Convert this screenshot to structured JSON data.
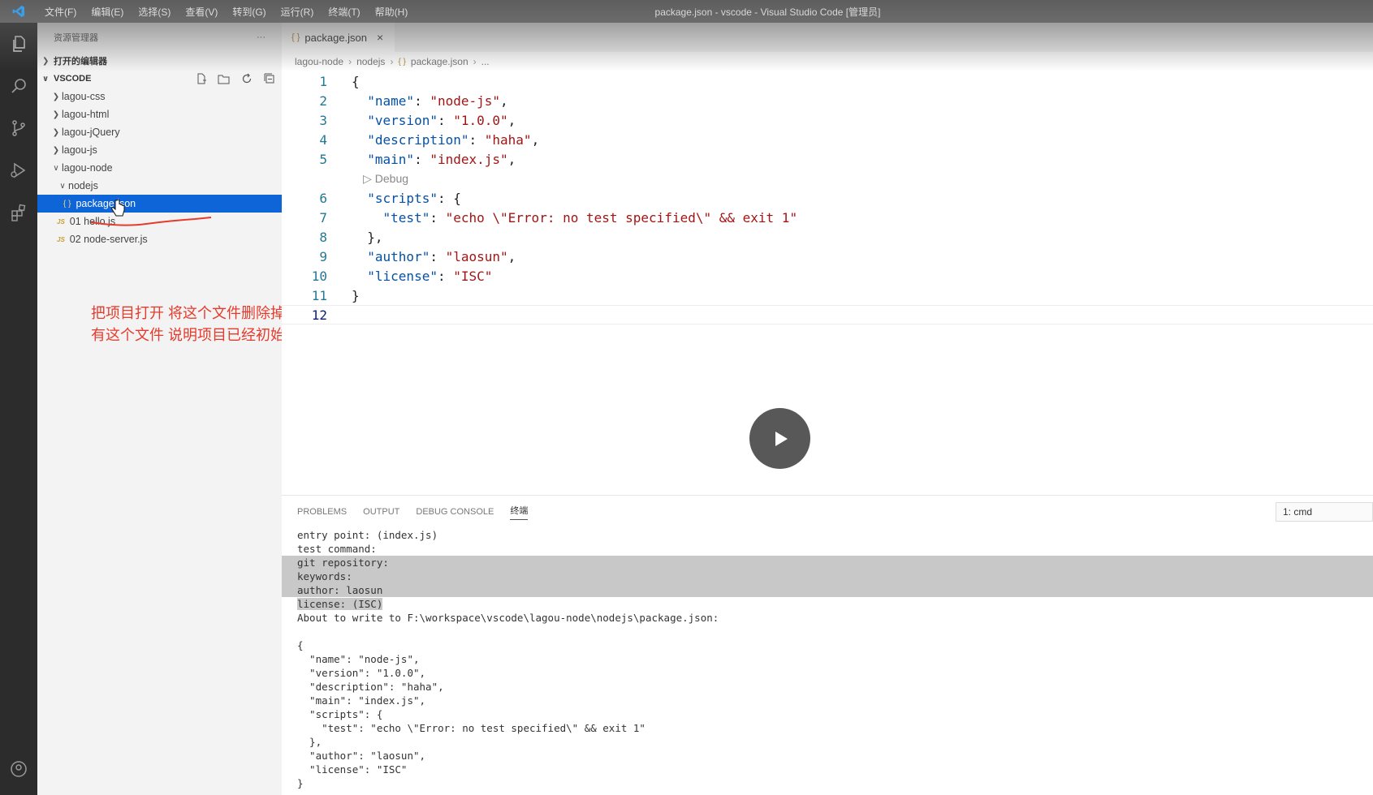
{
  "titlebar": {
    "menu": [
      "文件(F)",
      "编辑(E)",
      "选择(S)",
      "查看(V)",
      "转到(G)",
      "运行(R)",
      "终端(T)",
      "帮助(H)"
    ],
    "window_title": "package.json - vscode - Visual Studio Code [管理员]"
  },
  "sidebar": {
    "title": "资源管理器",
    "more": "···",
    "open_editors": "打开的编辑器",
    "workspace": "VSCODE",
    "items": [
      {
        "label": "lagou-css"
      },
      {
        "label": "lagou-html"
      },
      {
        "label": "lagou-jQuery"
      },
      {
        "label": "lagou-js"
      },
      {
        "label": "lagou-node"
      },
      {
        "label": "nodejs"
      },
      {
        "label": "package.json"
      },
      {
        "label": "01 hello.js"
      },
      {
        "label": "02 node-server.js"
      }
    ],
    "annotation": [
      "把项目打开 将这个文件删除掉",
      "有这个文件 说明项目已经初始化了"
    ]
  },
  "editor": {
    "tab_label": "package.json",
    "breadcrumb": [
      "lagou-node",
      "nodejs",
      "package.json",
      "..."
    ],
    "codelens": "Debug",
    "line_numbers": [
      "1",
      "2",
      "3",
      "4",
      "5",
      "6",
      "7",
      "8",
      "9",
      "10",
      "11",
      "12"
    ]
  },
  "panel": {
    "tabs": [
      "PROBLEMS",
      "OUTPUT",
      "DEBUG CONSOLE",
      "终端"
    ],
    "terminal_select": "1: cmd",
    "lines": [
      "entry point: (index.js)",
      "test command:",
      "git repository:",
      "keywords:",
      "author: laosun",
      "license: (ISC)",
      "About to write to F:\\workspace\\vscode\\lagou-node\\nodejs\\package.json:",
      "",
      "{",
      "  \"name\": \"node-js\",",
      "  \"version\": \"1.0.0\",",
      "  \"description\": \"haha\",",
      "  \"main\": \"index.js\",",
      "  \"scripts\": {",
      "    \"test\": \"echo \\\"Error: no test specified\\\" && exit 1\"",
      "  },",
      "  \"author\": \"laosun\",",
      "  \"license\": \"ISC\"",
      "}"
    ]
  },
  "colors": {
    "selection": "#0e65d8",
    "annotation": "#e53b2c",
    "json_key": "#0451a5",
    "json_string": "#a31515"
  }
}
